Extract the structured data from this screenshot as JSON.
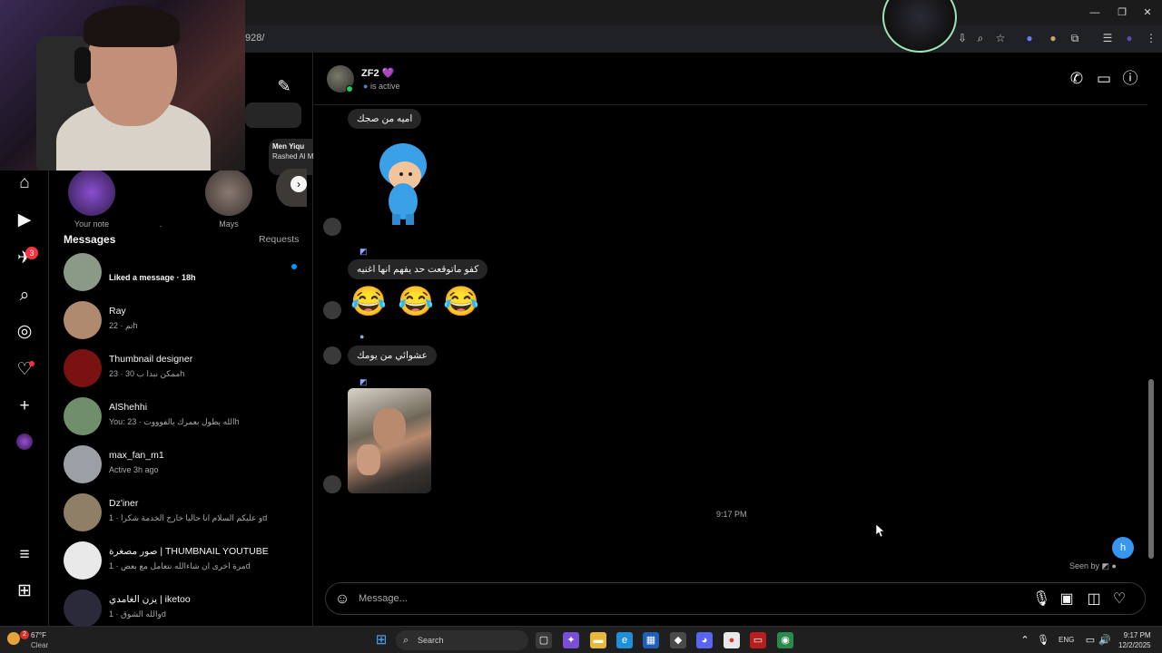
{
  "browser": {
    "url_fragment": "928/"
  },
  "inbox": {
    "notes": [
      {
        "label": "Your note"
      },
      {
        "label": "."
      },
      {
        "label": "Mays"
      }
    ],
    "note_bubble": {
      "title": "Men Yiqu",
      "subtitle": "Rashed Al M"
    },
    "messages_heading": "Messages",
    "requests_label": "Requests",
    "conversations": [
      {
        "name": "",
        "preview": "Liked a message · 18h",
        "unread": true,
        "color": "#8a9a86"
      },
      {
        "name": "Ray",
        "preview": "تم · 22h",
        "unread": false,
        "color": "#b08a6e"
      },
      {
        "name": "Thumbnail designer",
        "preview": "ممكن نبدا ب 30 · 23h",
        "unread": false,
        "color": "#7a1212"
      },
      {
        "name": "AlShehhi",
        "preview": "You: الله يطول بعمرك يالفوووت · 23h",
        "unread": false,
        "color": "#6f8f6a"
      },
      {
        "name": "max_fan_m1",
        "preview": "Active 3h ago",
        "unread": false,
        "color": "#9aa0a6"
      },
      {
        "name": "Dz'iner",
        "preview": "و عليكم السلام انا حاليا خارج الخدمة شكرا · 1d",
        "unread": false,
        "color": "#8e7f66"
      },
      {
        "name": "صور مصغرة | THUMBNAIL YOUTUBE",
        "preview": "مرة اخرى ان شاءالله نتعامل مع بعض · 1d",
        "unread": false,
        "color": "#e9e9e9"
      },
      {
        "name": "يزن الغامدي | iketoo",
        "preview": "والله الشوق · 1d",
        "unread": false,
        "color": "#2a2a3a"
      }
    ]
  },
  "rail": {
    "notification_count": "3"
  },
  "chat": {
    "name": "ZF2 💜",
    "status": "is active",
    "messages": [
      {
        "text": "اميه من صجك"
      },
      {
        "text": "كفو ماتوقعت حد يفهم انها اغنيه"
      },
      {
        "text": "عشوائي من يومك"
      }
    ],
    "emojis": [
      "😂",
      "😂",
      "😂"
    ],
    "timestamp": "9:17 PM",
    "own_message": "h",
    "seen": "Seen by",
    "composer_placeholder": "Message..."
  },
  "taskbar": {
    "weather_temp": "67°F",
    "weather_cond": "Clear",
    "weather_badge": "2",
    "search_label": "Search",
    "language": "ENG",
    "time": "9:17 PM",
    "date": "12/2/2025"
  }
}
